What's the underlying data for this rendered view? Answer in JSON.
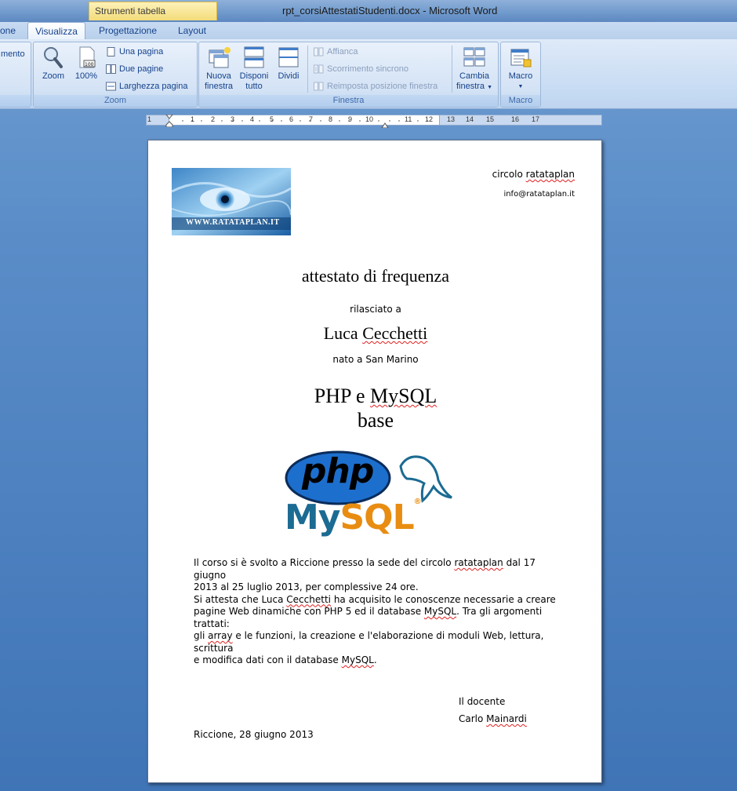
{
  "titlebar": {
    "context_tab": "Strumenti tabella",
    "title": "rpt_corsiAttestatiStudenti.docx  -  Microsoft Word"
  },
  "tabs": [
    "one",
    "Visualizza",
    "Progettazione",
    "Layout"
  ],
  "ribbon": {
    "partial_button": "mento",
    "zoom_group": {
      "label": "Zoom",
      "zoom": "Zoom",
      "zoom100": "100%",
      "one_page": "Una pagina",
      "two_pages": "Due pagine",
      "page_width": "Larghezza pagina"
    },
    "window_group": {
      "label": "Finestra",
      "new_window_1": "Nuova",
      "new_window_2": "finestra",
      "arrange_1": "Disponi",
      "arrange_2": "tutto",
      "split": "Dividi",
      "side_by_side": "Affianca",
      "sync_scroll": "Scorrimento sincrono",
      "reset_position": "Reimposta posizione finestra",
      "switch_1": "Cambia",
      "switch_2": "finestra"
    },
    "macro_group": {
      "label": "Macro",
      "macro": "Macro"
    }
  },
  "ruler": {
    "numbers": [
      "1",
      "1",
      "2",
      "3",
      "4",
      "5",
      "6",
      "7",
      "8",
      "9",
      "10",
      "11",
      "12",
      "13",
      "14",
      "15",
      "16",
      "17"
    ]
  },
  "document": {
    "org": "circolo ratataplan",
    "email": "info@ratataplan.it",
    "logo_text": "WWW.RATATAPLAN.IT",
    "heading": "attestato di frequenza",
    "issued_to": "rilasciato a",
    "student_first": "Luca",
    "student_last": "Cecchetti",
    "born_in": "nato a  San Marino",
    "course_1a": "PHP e ",
    "course_1b": "MySQL",
    "course_2": "base",
    "php_logo": "php",
    "mysql_logo": "MySQL",
    "body_lines": [
      "Il corso si è svolto a Riccione presso la sede del circolo ratataplan dal 17 giugno",
      "2013 al 25 luglio 2013, per complessive 24 ore.",
      "Si attesta che Luca Cecchetti ha acquisito le conoscenze necessarie a creare",
      "pagine Web dinamiche con PHP 5 ed il database MySQL. Tra gli argomenti trattati:",
      "gli array e le funzioni, la creazione e l'elaborazione di moduli Web, lettura, scrittura",
      "e modifica dati con il database MySQL."
    ],
    "teacher_label": "Il docente",
    "teacher_name": "Carlo Mainardi",
    "place_date": "Riccione, 28 giugno 2013"
  },
  "colors": {
    "ribbon_text": "#15428b",
    "php_blue": "#1d6fce",
    "mysql_blue": "#1b6b93",
    "mysql_orange": "#e88d12"
  }
}
